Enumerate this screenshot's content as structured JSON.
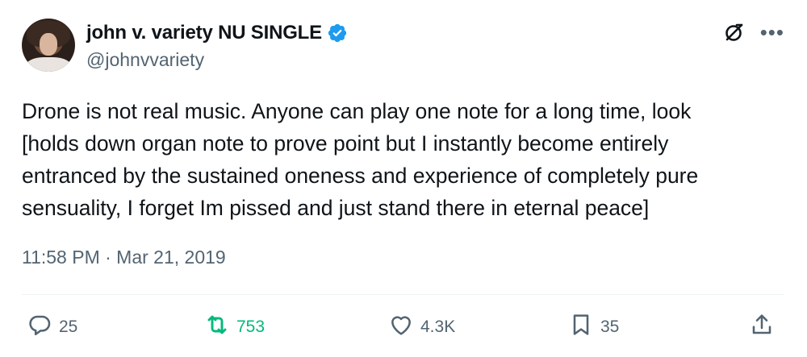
{
  "author": {
    "display_name": "john v. variety NU SINGLE",
    "handle": "@johnvvariety",
    "verified": true
  },
  "tweet": {
    "text": "Drone is not real music. Anyone can play one note for a long time, look\n[holds down organ note to prove point but I instantly become entirely\nentranced by the sustained oneness and experience of completely pure\nsensuality, I forget Im pissed and just stand there in eternal peace]",
    "timestamp": "11:58 PM · Mar 21, 2019"
  },
  "actions": {
    "replies": "25",
    "retweets": "753",
    "likes": "4.3K",
    "bookmarks": "35"
  },
  "icons": {
    "verified": "verified-badge-icon",
    "grok": "grok-icon",
    "more": "more-icon",
    "reply": "reply-icon",
    "retweet": "retweet-icon",
    "like": "heart-icon",
    "bookmark": "bookmark-icon",
    "share": "share-icon"
  },
  "colors": {
    "text": "#0f1419",
    "secondary": "#536471",
    "verified": "#1d9bf0",
    "retweet_active": "#00ba7c"
  }
}
